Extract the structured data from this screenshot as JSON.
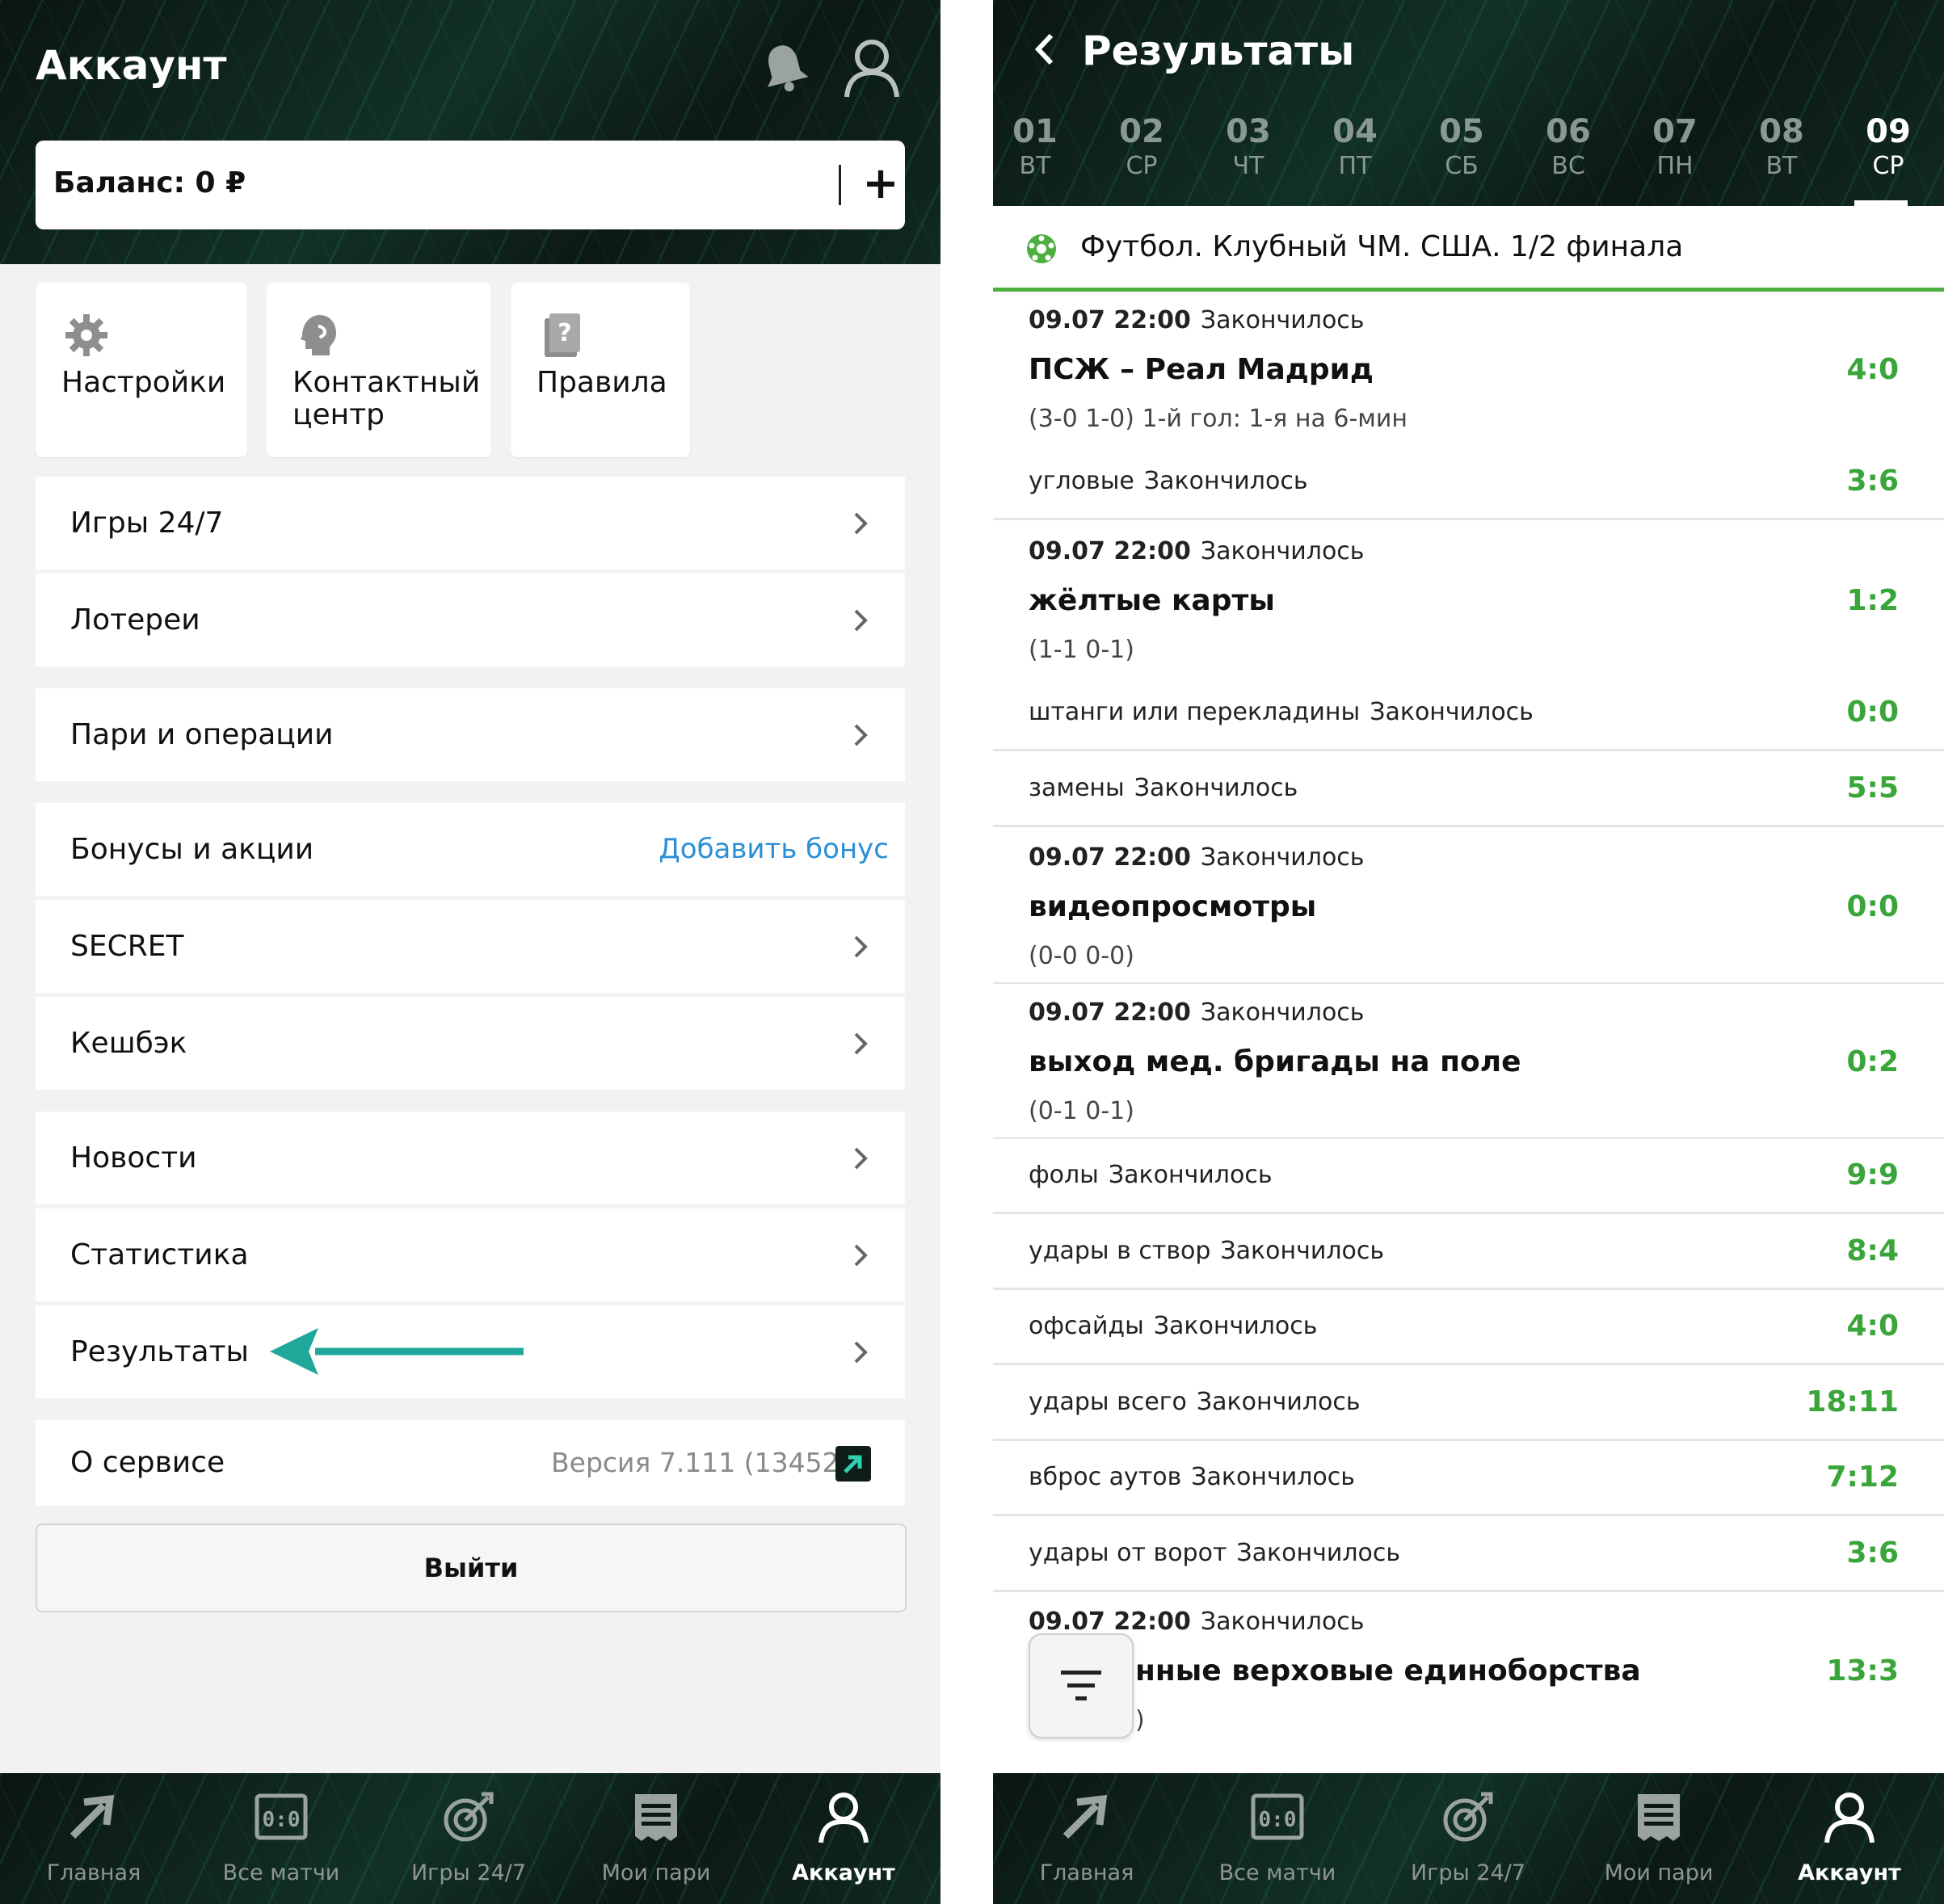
{
  "left": {
    "title": "Аккаунт",
    "balance": "Баланс: 0 ₽",
    "balance_add": "+",
    "tiles": [
      {
        "label": "Настройки",
        "icon": "gear-icon"
      },
      {
        "label": "Контактный\nцентр",
        "icon": "headset-icon"
      },
      {
        "label": "Правила",
        "icon": "rules-book-icon"
      }
    ],
    "menu": {
      "games": "Игры 24/7",
      "lotteries": "Лотереи",
      "bets_ops": "Пари и операции",
      "bonuses": "Бонусы и акции",
      "add_bonus": "Добавить бонус",
      "secret": "SECRET",
      "cashback": "Кешбэк",
      "news": "Новости",
      "stats": "Статистика",
      "results": "Результаты",
      "about": "О сервисе",
      "version": "Версия 7.111 (13452)"
    },
    "logout": "Выйти"
  },
  "nav": [
    {
      "label": "Главная",
      "icon": "home-arrow-icon"
    },
    {
      "label": "Все матчи",
      "icon": "scoreboard-icon"
    },
    {
      "label": "Игры 24/7",
      "icon": "target-icon"
    },
    {
      "label": "Мои пари",
      "icon": "receipt-icon"
    },
    {
      "label": "Аккаунт",
      "icon": "user-icon"
    }
  ],
  "right": {
    "title": "Результаты",
    "days": [
      {
        "num": "01",
        "wd": "ВТ"
      },
      {
        "num": "02",
        "wd": "СР"
      },
      {
        "num": "03",
        "wd": "ЧТ"
      },
      {
        "num": "04",
        "wd": "ПТ"
      },
      {
        "num": "05",
        "wd": "СБ"
      },
      {
        "num": "06",
        "wd": "ВС"
      },
      {
        "num": "07",
        "wd": "ПН"
      },
      {
        "num": "08",
        "wd": "ВТ"
      },
      {
        "num": "09",
        "wd": "СР"
      }
    ],
    "selected_day": "09",
    "section": "Футбол. Клубный ЧМ. США. 1/2 финала",
    "results": [
      {
        "datetime": "09.07 22:00",
        "status": "Закончилось",
        "name": "ПСЖ – Реал Мадрид",
        "detail": "(3-0 1-0) 1-й гол: 1-я на 6-мин",
        "score": "4:0"
      },
      {
        "label": "угловые",
        "status": "Закончилось",
        "score": "3:6"
      },
      {
        "datetime": "09.07 22:00",
        "status": "Закончилось",
        "name": "жёлтые карты",
        "detail": "(1-1 0-1)",
        "score": "1:2"
      },
      {
        "label": "штанги или перекладины",
        "status": "Закончилось",
        "score": "0:0"
      },
      {
        "label": "замены",
        "status": "Закончилось",
        "score": "5:5"
      },
      {
        "datetime": "09.07 22:00",
        "status": "Закончилось",
        "name": "видеопросмотры",
        "detail": "(0-0 0-0)",
        "score": "0:0"
      },
      {
        "datetime": "09.07 22:00",
        "status": "Закончилось",
        "name": "выход мед. бригады на поле",
        "detail": "(0-1 0-1)",
        "score": "0:2"
      },
      {
        "label": "фолы",
        "status": "Закончилось",
        "score": "9:9"
      },
      {
        "label": "удары в створ",
        "status": "Закончилось",
        "score": "8:4"
      },
      {
        "label": "офсайды",
        "status": "Закончилось",
        "score": "4:0"
      },
      {
        "label": "удары всего",
        "status": "Закончилось",
        "score": "18:11"
      },
      {
        "label": "вброс аутов",
        "status": "Закончилось",
        "score": "7:12"
      },
      {
        "label": "удары от ворот",
        "status": "Закончилось",
        "score": "3:6"
      },
      {
        "datetime": "09.07 22:00",
        "status": "Закончилось",
        "name": "нные верховые единоборства",
        "detail": ")",
        "score": "13:3"
      }
    ]
  },
  "colors": {
    "score_green": "#3aa63a",
    "section_underline": "#4caf3f",
    "link_blue": "#2a8fd6",
    "annotation_arrow": "#1fa89a",
    "header_dark": "#0d1612"
  }
}
